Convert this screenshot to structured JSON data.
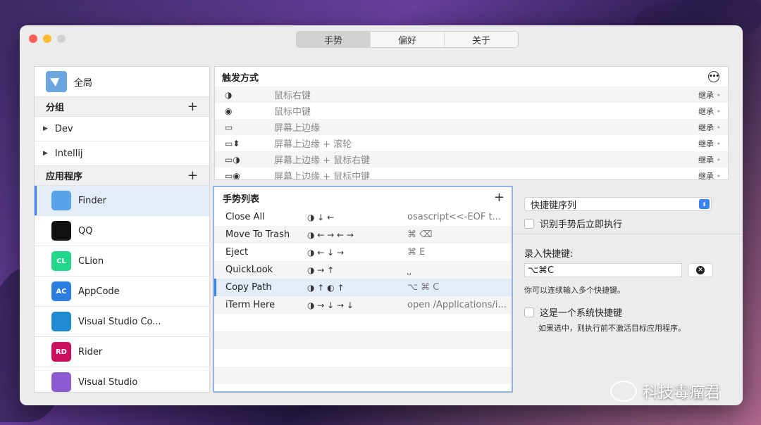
{
  "tabs": [
    "手势",
    "偏好",
    "关于"
  ],
  "sidebar": {
    "global_label": "全局",
    "groups_header": "分组",
    "groups": [
      "Dev",
      "Intellij"
    ],
    "apps_header": "应用程序",
    "apps": [
      {
        "name": "Finder",
        "color": "#5aa3e8",
        "glyph": ""
      },
      {
        "name": "QQ",
        "color": "#111111",
        "glyph": ""
      },
      {
        "name": "CLion",
        "color": "#21d789",
        "glyph": "CL"
      },
      {
        "name": "AppCode",
        "color": "#2b7ee0",
        "glyph": "AC"
      },
      {
        "name": "Visual Studio Co...",
        "color": "#1f8ad2",
        "glyph": ""
      },
      {
        "name": "Rider",
        "color": "#c90f5e",
        "glyph": "RD"
      },
      {
        "name": "Visual Studio",
        "color": "#8c5ad1",
        "glyph": ""
      }
    ]
  },
  "trigger": {
    "title": "触发方式",
    "rows": [
      {
        "icons": "◑",
        "label": "鼠标右键",
        "inherit": "继承"
      },
      {
        "icons": "◉",
        "label": "鼠标中键",
        "inherit": "继承"
      },
      {
        "icons": "▭",
        "label": "屏幕上边缘",
        "inherit": "继承"
      },
      {
        "icons": "▭⬍",
        "label": "屏幕上边缘 + 滚轮",
        "inherit": "继承"
      },
      {
        "icons": "▭◑",
        "label": "屏幕上边缘 + 鼠标右键",
        "inherit": "继承"
      },
      {
        "icons": "▭◉",
        "label": "屏幕上边缘 + 鼠标中键",
        "inherit": "继承"
      }
    ]
  },
  "gestures": {
    "title": "手势列表",
    "rows": [
      {
        "name": "Close All",
        "gesture": "◑ ↓ ←",
        "action": "osascript<<-EOF   t..."
      },
      {
        "name": "Move To Trash",
        "gesture": "◑ ← → ← →",
        "action": "⌘ ⌫"
      },
      {
        "name": "Eject",
        "gesture": "◑ ← ↓ →",
        "action": "⌘ E"
      },
      {
        "name": "QuickLook",
        "gesture": "◑ → ↑",
        "action": "⎵"
      },
      {
        "name": "Copy Path",
        "gesture": "◑ ↑ ◐ ↑",
        "action": "⌥ ⌘ C"
      },
      {
        "name": "iTerm Here",
        "gesture": "◑ → ↓ → ↓",
        "action": "open /Applications/i..."
      }
    ],
    "selected_index": 4
  },
  "detail": {
    "action_type": "快捷键序列",
    "run_immediately_label": "识别手势后立即执行",
    "record_label": "录入快捷键:",
    "hotkey_value": "⌥⌘C",
    "multi_note": "你可以连续输入多个快捷键。",
    "system_hotkey_label": "这是一个系统快捷键",
    "system_hotkey_note": "如果选中，则执行前不激活目标应用程序。"
  },
  "watermark": "科技毒瘤君"
}
